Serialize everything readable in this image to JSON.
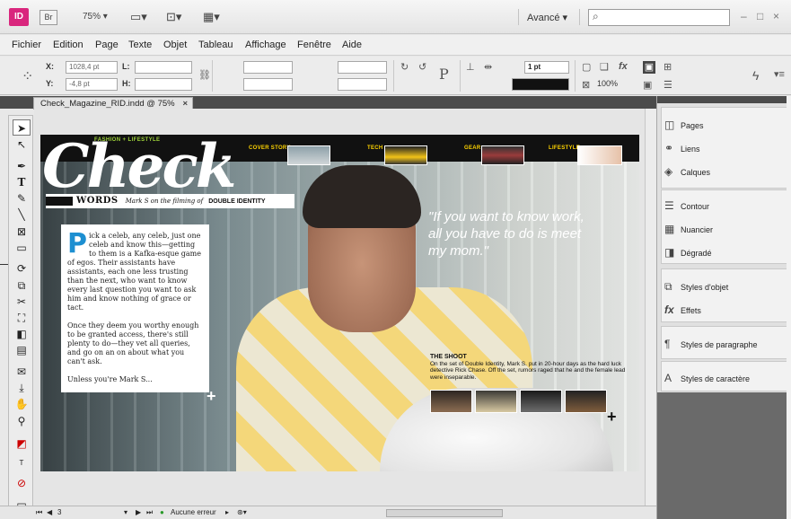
{
  "app": {
    "logo": "ID",
    "bridge": "Br",
    "zoom": "75%",
    "workspace": "Avancé",
    "search_placeholder": "",
    "window_controls": [
      "–",
      "□",
      "×"
    ]
  },
  "menu": [
    "Fichier",
    "Edition",
    "Page",
    "Texte",
    "Objet",
    "Tableau",
    "Affichage",
    "Fenêtre",
    "Aide"
  ],
  "control": {
    "x_label": "X:",
    "x_value": "1028,4 pt",
    "y_label": "Y:",
    "y_value": "-4,8 pt",
    "w_label": "L:",
    "h_label": "H:",
    "stroke_weight": "1 pt",
    "opacity": "100%",
    "char_label": "P"
  },
  "document": {
    "tab": "Check_Magazine_RID.indd @ 75%",
    "close": "×"
  },
  "spread": {
    "masthead": "Check",
    "tagline": "FASHION + LIFESTYLE",
    "nav": [
      "COVER STORY",
      "TECH",
      "GEAR",
      "LIFESTYLE"
    ],
    "words_title": "WORDS",
    "words_sub": "Mark S on the filming of",
    "words_bold": "DOUBLE IDENTITY",
    "dropcap": "P",
    "para1": "ick a celeb, any celeb, just one celeb and know this—getting to them is a Kafka-esque game of egos. Their assistants have assistants, each one less trusting than the next, who want to know every last question you want to ask him and know nothing of grace or tact.",
    "para2": "Once they deem you worthy enough to be granted access, there's still plenty to do—they vet all queries, and go on an on about what you can't ask.",
    "para3": "Unless you're Mark S...",
    "quote": "\"If you want to know work, all you have to do is meet my mom.\"",
    "shoot_title": "THE SHOOT",
    "shoot_text": "On the set of Double Identity, Mark S. put in 20-hour days as the hard luck detective Rick Chase. Off the set, rumors raged that he and the female lead were inseparable."
  },
  "status": {
    "page": "3",
    "errors": "Aucune erreur"
  },
  "panels": [
    {
      "icon": "pages-icon",
      "label": "Pages"
    },
    {
      "icon": "links-icon",
      "label": "Liens"
    },
    {
      "icon": "layers-icon",
      "label": "Calques"
    },
    {
      "icon": "stroke-icon",
      "label": "Contour"
    },
    {
      "icon": "swatches-icon",
      "label": "Nuancier"
    },
    {
      "icon": "gradient-icon",
      "label": "Dégradé"
    },
    {
      "icon": "object-styles-icon",
      "label": "Styles d'objet"
    },
    {
      "icon": "effects-icon",
      "label": "Effets"
    },
    {
      "icon": "paragraph-styles-icon",
      "label": "Styles de paragraphe"
    },
    {
      "icon": "character-styles-icon",
      "label": "Styles de caractère"
    }
  ]
}
